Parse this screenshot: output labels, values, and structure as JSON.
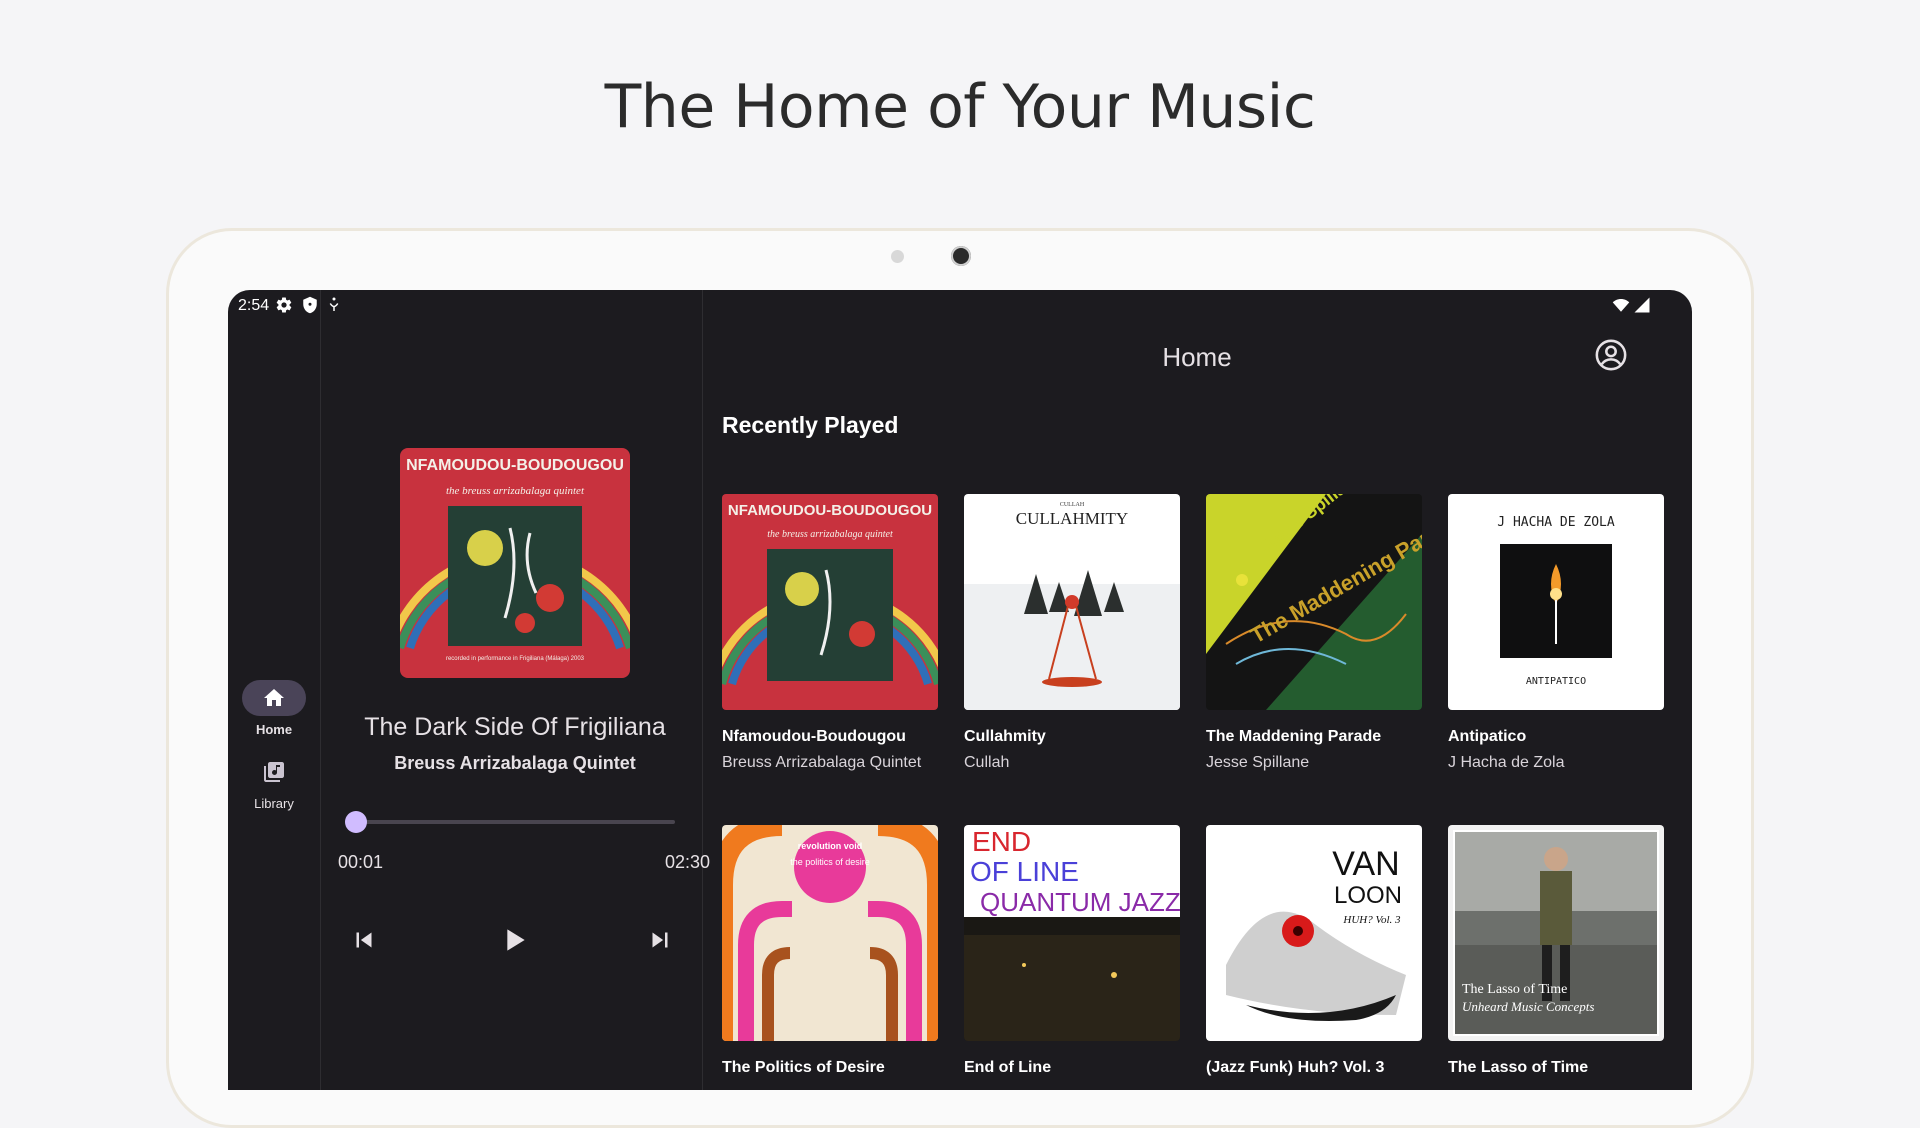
{
  "hero": {
    "title": "The Home of Your Music"
  },
  "status_bar": {
    "time": "2:54"
  },
  "nav_rail": {
    "items": [
      {
        "label": "Home",
        "icon": "home-icon",
        "active": true
      },
      {
        "label": "Library",
        "icon": "library-music-icon",
        "active": false
      }
    ]
  },
  "now_playing": {
    "title": "The Dark Side Of Frigiliana",
    "artist": "Breuss Arrizabalaga Quintet",
    "current_time": "00:01",
    "total_time": "02:30",
    "progress": 0.01,
    "art": {
      "top_text": "NFAMOUDOU-BOUDOUGOU",
      "sub_text": "the breuss arrizabalaga quintet",
      "bottom_text": "recorded in performance in Frigiliana (Málaga) 2003"
    }
  },
  "main": {
    "title": "Home",
    "section_title": "Recently Played",
    "albums": [
      {
        "name": "Nfamoudou-Boudougou",
        "artist": "Breuss Arrizabalaga Quintet",
        "cover": {
          "line1": "NFAMOUDOU-BOUDOUGOU",
          "line2": "the breuss arrizabalaga quintet"
        }
      },
      {
        "name": "Cullahmity",
        "artist": "Cullah",
        "cover": {
          "line1": "CULLAHMITY",
          "line2": "CULLAH"
        }
      },
      {
        "name": "The Maddening Parade",
        "artist": "Jesse Spillane",
        "cover": {
          "line1": "Jesse Spillane",
          "line2": "The Maddening Parade"
        }
      },
      {
        "name": "Antipatico",
        "artist": "J Hacha de Zola",
        "cover": {
          "line1": "J HACHA DE ZOLA",
          "line2": "ANTIPATICO"
        }
      },
      {
        "name": "The Politics of Desire",
        "artist": "",
        "cover": {
          "line1": "revolution void",
          "line2": "the politics of desire"
        }
      },
      {
        "name": "End of Line",
        "artist": "",
        "cover": {
          "line1": "END",
          "line2": "OF LINE",
          "line3": "QUANTUM JAZZ"
        }
      },
      {
        "name": "(Jazz Funk) Huh? Vol. 3",
        "artist": "",
        "cover": {
          "line1": "VAN",
          "line2": "LOON",
          "line3": "HUH? Vol. 3"
        }
      },
      {
        "name": "The Lasso of Time",
        "artist": "",
        "cover": {
          "line1": "The Lasso of Time",
          "line2": "Unheard Music Concepts"
        }
      }
    ]
  },
  "colors": {
    "surface": "#1c1b1f",
    "accent": "#d0bcff",
    "rail_pill": "#4a4458",
    "page_bg": "#f5f5f7"
  }
}
